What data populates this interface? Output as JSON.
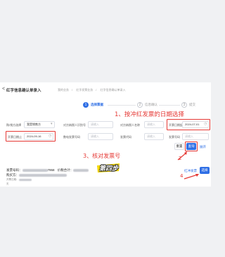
{
  "header": {
    "back": "<",
    "title": "红字信息确认单录入",
    "breadcrumbs": [
      "我的业务",
      "红字发票业务",
      "红字信息确认单录入"
    ]
  },
  "steps": [
    {
      "num": "1",
      "label": "选择票据"
    },
    {
      "num": "2",
      "label": "信息确认"
    },
    {
      "num": "3",
      "label": "提交"
    }
  ],
  "form": {
    "buyer_seller_label": "购/销方选择",
    "buyer_seller_value": "我是销售方",
    "counterparty_tax_label": "对方纳税人识别号",
    "counterparty_tax_placeholder": "请输入",
    "counterparty_name_label": "对方纳税人名称",
    "counterparty_name_placeholder": "请输入",
    "issue_start_label": "开票日期起",
    "issue_start_value": "2024-07-01",
    "issue_end_label": "开票日期止",
    "issue_end_value": "2024-09-16",
    "invoice_no_label": "数电发票号码",
    "invoice_no_placeholder": "请输入",
    "invoice_code_label": "发票代码",
    "invoice_code_placeholder": "请输入",
    "invoice_number_label": "发票号码",
    "invoice_number_placeholder": "请输入"
  },
  "buttons": {
    "reset": "重置",
    "query": "查询",
    "expand": "展开",
    "confirm_red": "红冲发票",
    "submit": "选择"
  },
  "annotations": {
    "a1": "1、按冲红发票的日期选择",
    "a2": "2",
    "a3": "3、核对发票号",
    "a4": "4",
    "sticker": "第四步"
  },
  "invoice": {
    "no_label": "发票号码：",
    "no_visible_suffix": "7958",
    "buyer_label": "价税合计：",
    "amount_label": "购买方：",
    "date_label": "开票日期：",
    "note": "无"
  },
  "colors": {
    "primary": "#2f6fe5",
    "annotation_red": "#e53935",
    "sticker_yellow": "#f5d800"
  }
}
